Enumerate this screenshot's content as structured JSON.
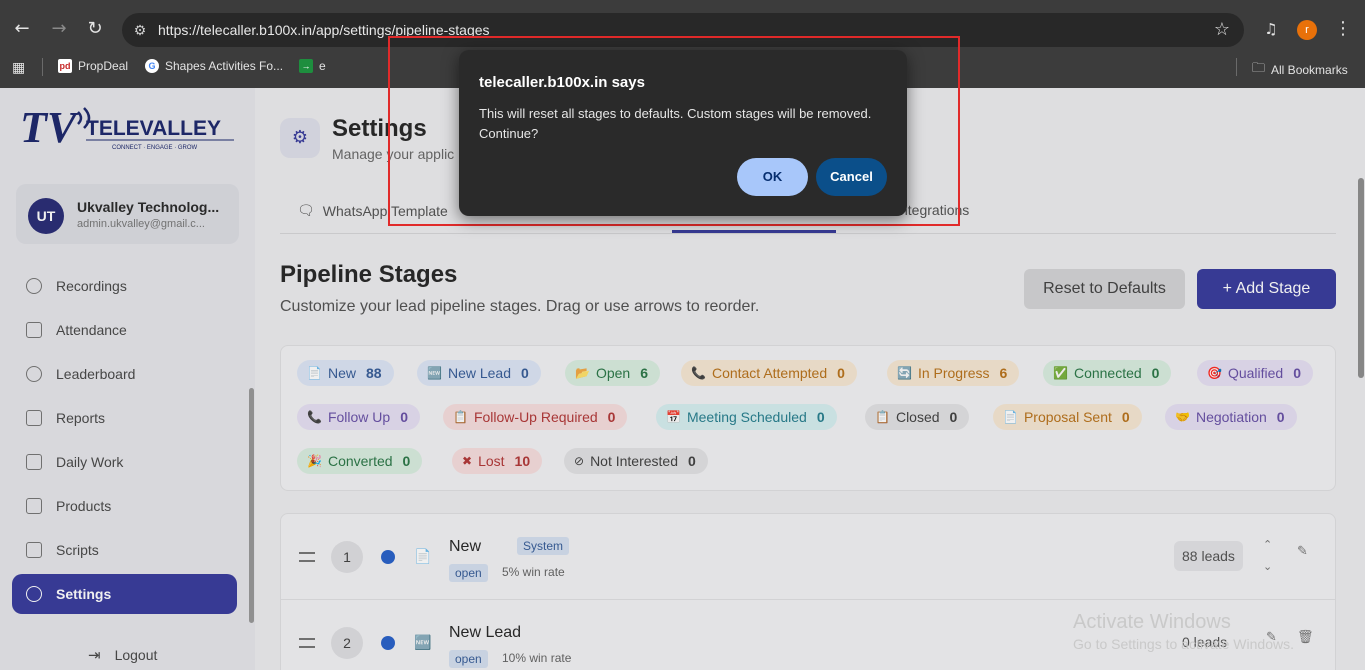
{
  "browser": {
    "url": "https://telecaller.b100x.in/app/settings/pipeline-stages",
    "profile_initial": "r",
    "bookmarks": [
      {
        "label": "PropDeal",
        "fav": "pd",
        "color": "#ffffff"
      },
      {
        "label": "Shapes Activities Fo...",
        "fav": "G",
        "color": "#ffffff"
      },
      {
        "label": "e",
        "fav": "→",
        "color": "#1e8e3e"
      }
    ],
    "all_bookmarks": "All Bookmarks"
  },
  "sidebar": {
    "brand": "TELEVALLEY",
    "brand_tagline": "CONNECT · ENGAGE · GROW",
    "user": {
      "initials": "UT",
      "name": "Ukvalley Technolog...",
      "email": "admin.ukvalley@gmail.c..."
    },
    "items": [
      {
        "label": "Recordings"
      },
      {
        "label": "Attendance"
      },
      {
        "label": "Leaderboard"
      },
      {
        "label": "Reports"
      },
      {
        "label": "Daily Work"
      },
      {
        "label": "Products"
      },
      {
        "label": "Scripts"
      },
      {
        "label": "Settings"
      }
    ],
    "logout": "Logout"
  },
  "header": {
    "title": "Settings",
    "subtitle": "Manage your applic"
  },
  "tabs": [
    {
      "label": "WhatsApp Template"
    },
    {
      "label": "ntegrations"
    }
  ],
  "pipeline": {
    "title": "Pipeline Stages",
    "subtitle": "Customize your lead pipeline stages. Drag or use arrows to reorder.",
    "reset_label": "Reset to Defaults",
    "add_label": "+ Add Stage",
    "chips": [
      {
        "label": "New",
        "count": "88",
        "icon": "📄",
        "bg": "#dce5f5",
        "fg": "#3a5f9a"
      },
      {
        "label": "New Lead",
        "count": "0",
        "icon": "🆕",
        "bg": "#dce5f5",
        "fg": "#3a5f9a"
      },
      {
        "label": "Open",
        "count": "6",
        "icon": "📂",
        "bg": "#d9ede0",
        "fg": "#2e7a4a"
      },
      {
        "label": "Contact Attempted",
        "count": "0",
        "icon": "📞",
        "bg": "#f6e7d3",
        "fg": "#b9741e"
      },
      {
        "label": "In Progress",
        "count": "6",
        "icon": "🔄",
        "bg": "#f6e7d3",
        "fg": "#b9741e"
      },
      {
        "label": "Connected",
        "count": "0",
        "icon": "✅",
        "bg": "#d9ede0",
        "fg": "#2e7a4a"
      },
      {
        "label": "Qualified",
        "count": "0",
        "icon": "🎯",
        "bg": "#e6e0f3",
        "fg": "#6b53a8"
      },
      {
        "label": "Follow Up",
        "count": "0",
        "icon": "📞",
        "bg": "#e6e0f3",
        "fg": "#6b53a8"
      },
      {
        "label": "Follow-Up Required",
        "count": "0",
        "icon": "📋",
        "bg": "#f6dede",
        "fg": "#b33a3a"
      },
      {
        "label": "Meeting Scheduled",
        "count": "0",
        "icon": "📅",
        "bg": "#d6eef0",
        "fg": "#2a8190"
      },
      {
        "label": "Closed",
        "count": "0",
        "icon": "📋",
        "bg": "#e2e2e4",
        "fg": "#444444"
      },
      {
        "label": "Proposal Sent",
        "count": "0",
        "icon": "📄",
        "bg": "#f6e7d3",
        "fg": "#b9741e"
      },
      {
        "label": "Negotiation",
        "count": "0",
        "icon": "🤝",
        "bg": "#e6e0f3",
        "fg": "#6b53a8"
      },
      {
        "label": "Converted",
        "count": "0",
        "icon": "🎉",
        "bg": "#d9ede0",
        "fg": "#2e7a4a"
      },
      {
        "label": "Lost",
        "count": "10",
        "icon": "✖",
        "bg": "#f6dede",
        "fg": "#b33a3a"
      },
      {
        "label": "Not Interested",
        "count": "0",
        "icon": "⊘",
        "bg": "#e2e2e4",
        "fg": "#444444"
      }
    ],
    "stages": [
      {
        "order": "1",
        "name": "New",
        "system": "System",
        "type": "open",
        "win": "5% win rate",
        "leads": "88 leads",
        "dot": "#2b63c9",
        "icon": "📄"
      },
      {
        "order": "2",
        "name": "New Lead",
        "system": "",
        "type": "open",
        "win": "10% win rate",
        "leads": "0 leads",
        "dot": "#2b63c9",
        "icon": "🆕"
      }
    ]
  },
  "dialog": {
    "title": "telecaller.b100x.in says",
    "message": "This will reset all stages to defaults. Custom stages will be removed. Continue?",
    "ok": "OK",
    "cancel": "Cancel"
  },
  "watermark": {
    "line1": "Activate Windows",
    "line2": "Go to Settings to activate Windows."
  }
}
